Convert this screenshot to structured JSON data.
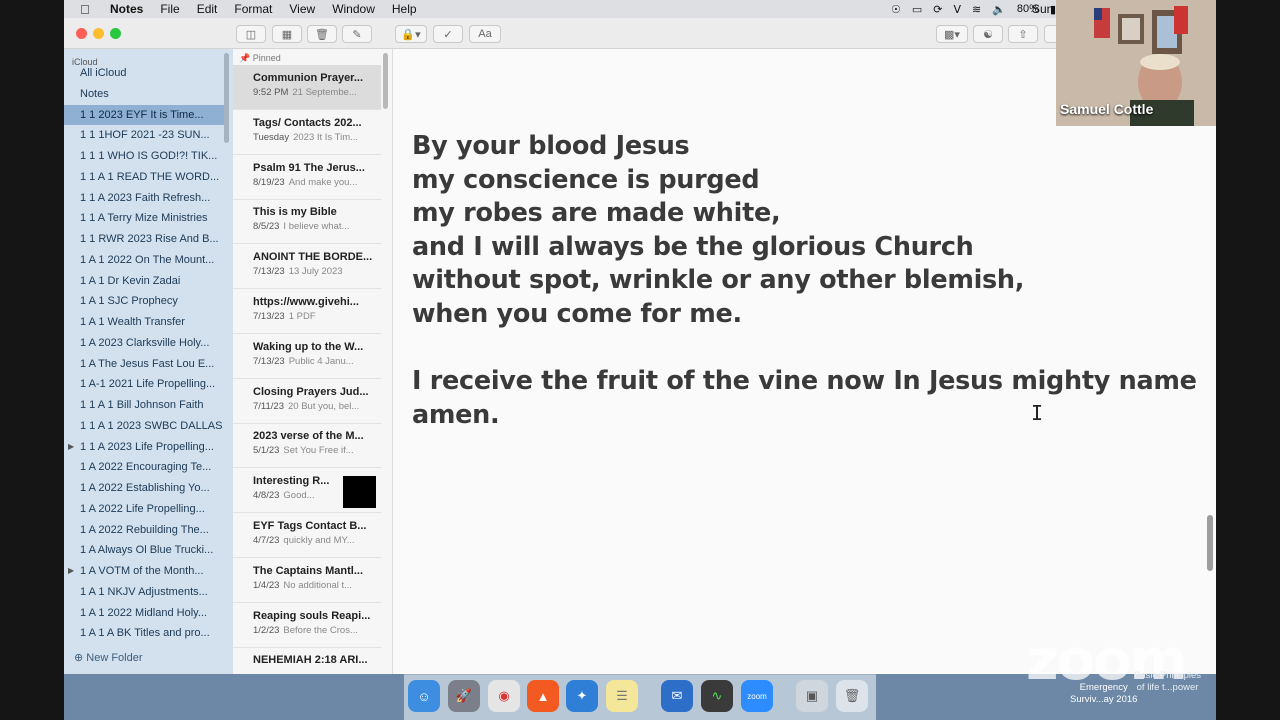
{
  "menubar": {
    "app": "Notes",
    "items": [
      "File",
      "Edit",
      "Format",
      "View",
      "Window",
      "Help"
    ],
    "battery": "80%",
    "clock": "Sun"
  },
  "sidebar": {
    "header": "iCloud",
    "items": [
      {
        "label": "All iCloud"
      },
      {
        "label": "Notes"
      },
      {
        "label": "1  1   2023 EYF  It is Time..."
      },
      {
        "label": "1  1   1HOF 2021 -23 SUN..."
      },
      {
        "label": "1  1  1 WHO IS GOD!?!  TIK..."
      },
      {
        "label": "1  1 A   1 READ THE WORD..."
      },
      {
        "label": "1  1 A  2023 Faith Refresh..."
      },
      {
        "label": "1  1 A Terry Mize Ministries"
      },
      {
        "label": "1  1 RWR 2023 Rise And B..."
      },
      {
        "label": "1  A  1 2022 On The Mount..."
      },
      {
        "label": "1  A  1 Dr Kevin Zadai"
      },
      {
        "label": "1  A  1 SJC Prophecy"
      },
      {
        "label": "1  A  1 Wealth Transfer"
      },
      {
        "label": "1  A   2023 Clarksville Holy..."
      },
      {
        "label": "1  A  The Jesus Fast Lou E..."
      },
      {
        "label": "1  A-1 2021 Life Propelling..."
      },
      {
        "label": "1 1 A  1 Bill Johnson Faith"
      },
      {
        "label": "1 1 A 1 2023 SWBC DALLAS"
      },
      {
        "label": "1 1 A 2023 Life Propelling..."
      },
      {
        "label": "1 A   2022 Encouraging Te..."
      },
      {
        "label": "1 A   2022 Establishing Yo..."
      },
      {
        "label": "1 A   2022 Life Propelling..."
      },
      {
        "label": "1 A   2022 Rebuilding The..."
      },
      {
        "label": "1 A   Always Ol Blue Trucki..."
      },
      {
        "label": "1 A   VOTM of the Month..."
      },
      {
        "label": "1 A  1   NKJV Adjustments..."
      },
      {
        "label": "1 A  1  2022 Midland Holy..."
      },
      {
        "label": "1 A  1  A BK Titles and pro..."
      }
    ],
    "new_folder": "New Folder"
  },
  "notes_list": {
    "pinned_label": "Pinned",
    "notes": [
      {
        "title": "Communion Prayer...",
        "date": "9:52 PM",
        "snippet": "21 Septembe..."
      },
      {
        "title": "Tags/ Contacts 202...",
        "date": "Tuesday",
        "snippet": "2023 It Is Tim..."
      },
      {
        "title": "Psalm 91 The Jerus...",
        "date": "8/19/23",
        "snippet": "And make you..."
      },
      {
        "title": "This is my Bible",
        "date": "8/5/23",
        "snippet": "I believe what..."
      },
      {
        "title": "ANOINT THE BORDE...",
        "date": "7/13/23",
        "snippet": "13 July 2023"
      },
      {
        "title": "https://www.givehi...",
        "date": "7/13/23",
        "snippet": "1 PDF"
      },
      {
        "title": "Waking up to the W...",
        "date": "7/13/23",
        "snippet": "Public 4 Janu..."
      },
      {
        "title": "Closing Prayers Jud...",
        "date": "7/11/23",
        "snippet": "20 But you, bel..."
      },
      {
        "title": "2023 verse of the M...",
        "date": "5/1/23",
        "snippet": "Set You Free if..."
      },
      {
        "title": "Interesting R...",
        "date": "4/8/23",
        "snippet": "Good..."
      },
      {
        "title": "EYF Tags Contact B...",
        "date": "4/7/23",
        "snippet": "quickly and MY..."
      },
      {
        "title": "The Captains Mantl...",
        "date": "1/4/23",
        "snippet": "No additional t..."
      },
      {
        "title": "Reaping souls Reapi...",
        "date": "1/2/23",
        "snippet": "Before the Cros..."
      },
      {
        "title": "NEHEMIAH 2:18 ARI...",
        "date": "",
        "snippet": ""
      }
    ]
  },
  "editor": {
    "text": "By your blood Jesus\nmy conscience is purged\nmy robes are made white,\nand I will always be the glorious Church\nwithout spot, wrinkle or any other blemish,\nwhen you come for me.\n\nI receive the fruit of the vine now In Jesus mighty name\namen."
  },
  "toolbar": {
    "format_label": "Aa"
  },
  "zoom": {
    "participant_name": "Samuel Cottle",
    "watermark": "zoom",
    "desktop_labels": [
      "Emergency\nSurviv...ay 2016",
      "Basic Principles\nof life t...power"
    ]
  },
  "dock": {
    "apps": [
      "finder-icon",
      "launchpad-icon",
      "chrome-icon",
      "brave-icon",
      "safari-like-icon",
      "notes-icon",
      "mail-icon",
      "activity-monitor-icon",
      "zoom-icon",
      "preview-icon",
      "trash-icon"
    ],
    "zoom_label": "zoom"
  }
}
